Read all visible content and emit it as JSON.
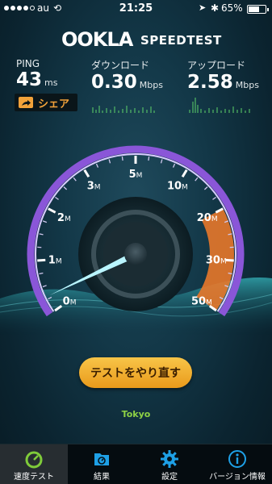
{
  "status_bar": {
    "signal_dots": [
      true,
      true,
      true,
      true,
      false
    ],
    "carrier": "au",
    "sync_icon": "sync-icon",
    "time": "21:25",
    "location_icon": "location-arrow-icon",
    "bluetooth_icon": "bluetooth-icon",
    "battery_percent": "65%",
    "battery_level": 0.65
  },
  "header": {
    "logo": "OOKLA",
    "app_name": "SPEEDTEST"
  },
  "metrics": {
    "ping": {
      "label": "PING",
      "value": "43",
      "unit": "ms"
    },
    "download": {
      "label": "ダウンロード",
      "value": "0.30",
      "unit": "Mbps"
    },
    "upload": {
      "label": "アップロード",
      "value": "2.58",
      "unit": "Mbps"
    }
  },
  "share": {
    "label": "シェア",
    "icon": "share-arrow-icon"
  },
  "gauge": {
    "ticks": [
      {
        "label": "0",
        "unit": "M"
      },
      {
        "label": "1",
        "unit": "M"
      },
      {
        "label": "2",
        "unit": "M"
      },
      {
        "label": "3",
        "unit": "M"
      },
      {
        "label": "5",
        "unit": "M"
      },
      {
        "label": "10",
        "unit": "M"
      },
      {
        "label": "20",
        "unit": "M"
      },
      {
        "label": "30",
        "unit": "M"
      },
      {
        "label": "50",
        "unit": "M"
      }
    ],
    "current_value": 0.3,
    "colors": {
      "ring": "#8a56d8",
      "highlight": "#e8782a",
      "needle": "#b9f5ff"
    }
  },
  "action": {
    "test_again_label": "テストをやり直す"
  },
  "server": {
    "name": "Tokyo"
  },
  "tabs": [
    {
      "label": "速度テスト",
      "icon": "speedometer-icon",
      "active": true
    },
    {
      "label": "結果",
      "icon": "results-folder-icon",
      "active": false
    },
    {
      "label": "設定",
      "icon": "gear-icon",
      "active": false
    },
    {
      "label": "バージョン情報",
      "icon": "info-icon",
      "active": false
    }
  ]
}
